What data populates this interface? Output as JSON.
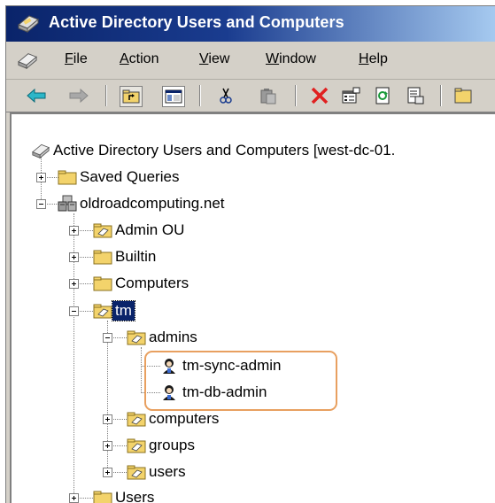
{
  "window": {
    "title": "Active Directory Users and Computers"
  },
  "menu": {
    "items": [
      {
        "label": "File",
        "underline": "F"
      },
      {
        "label": "Action",
        "underline": "A"
      },
      {
        "label": "View",
        "underline": "V"
      },
      {
        "label": "Window",
        "underline": "W"
      },
      {
        "label": "Help",
        "underline": "H"
      }
    ]
  },
  "toolbar": {
    "buttons": [
      "back-arrow-icon",
      "forward-arrow-icon",
      "up-folder-icon",
      "show-hide-tree-icon",
      "cut-icon",
      "paste-icon",
      "delete-icon",
      "properties-icon",
      "refresh-icon",
      "export-list-icon",
      "help-icon"
    ]
  },
  "tree": {
    "root": "Active Directory Users and Computers [west-dc-01.",
    "saved_queries": "Saved Queries",
    "domain": "oldroadcomputing.net",
    "admin_ou": "Admin OU",
    "builtin": "Builtin",
    "computers": "Computers",
    "tm": "tm",
    "admins": "admins",
    "user1": "tm-sync-admin",
    "user2": "tm-db-admin",
    "tm_computers": "computers",
    "groups": "groups",
    "users": "users",
    "users_container": "Users"
  },
  "colors": {
    "title_bar": "#0a246a",
    "selection": "#0a246a",
    "highlight_outline": "#e8a060",
    "folder_yellow": "#f3d36b"
  }
}
